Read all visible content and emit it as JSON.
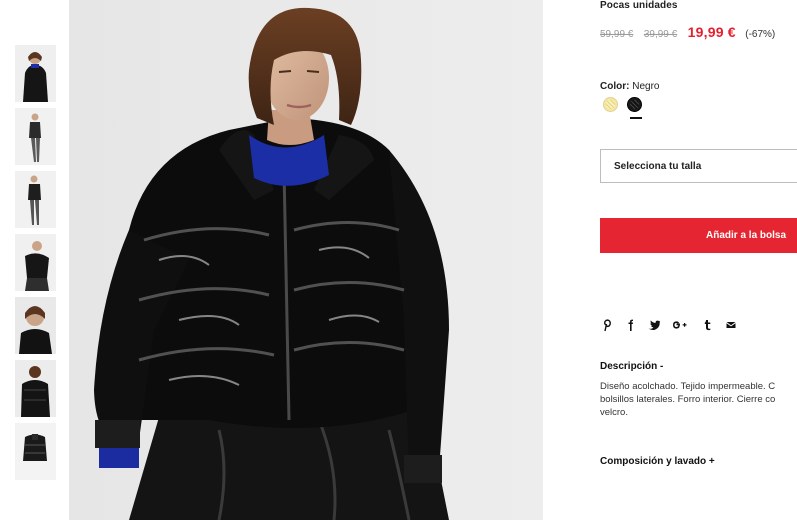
{
  "product": {
    "stock_status": "Pocas unidades",
    "prices": {
      "original": "59,99 €",
      "previous": "39,99 €",
      "current": "19,99 €",
      "discount": "(-67%)"
    },
    "color": {
      "label": "Color:",
      "value": "Negro",
      "swatches": [
        "yellow",
        "black"
      ],
      "selected": "black"
    },
    "size_select_placeholder": "Selecciona tu talla",
    "add_to_bag_label": "Añadir a la bolsa",
    "share_icons": [
      "pinterest-icon",
      "facebook-icon",
      "twitter-icon",
      "google-plus-icon",
      "tumblr-icon",
      "email-icon"
    ],
    "description": {
      "title": "Descripción -",
      "lines": [
        "Diseño acolchado. Tejido impermeable. C",
        "bolsillos laterales. Forro interior. Cierre co",
        "velcro."
      ]
    },
    "composition_title": "Composición y lavado +"
  },
  "colors": {
    "sale": "#e5202e",
    "button": "#e52632",
    "text": "#111111"
  }
}
